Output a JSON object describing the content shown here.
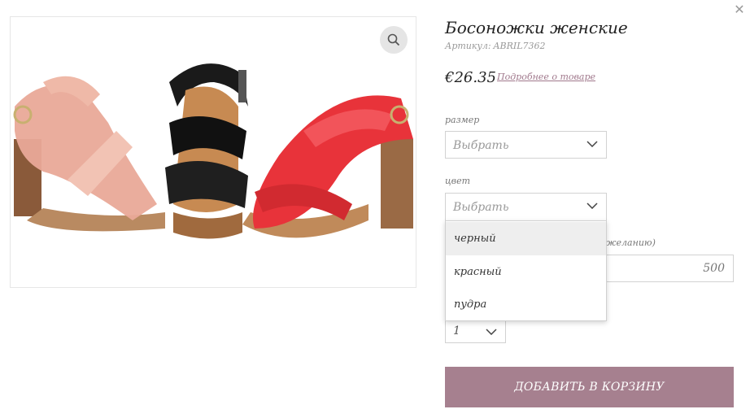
{
  "product": {
    "title": "Босоножки женские",
    "sku_label": "Артикул:",
    "sku_value": "ABRIL7362",
    "price": "€26.35",
    "more_link": "Подробнее о товаре"
  },
  "options": {
    "size": {
      "label": "размер",
      "value": "Выбрать"
    },
    "color": {
      "label": "цвет",
      "value": "Выбрать",
      "open": true,
      "options": [
        "черный",
        "красный",
        "пудра"
      ],
      "highlighted": "черный"
    },
    "partial_label": "желанию)",
    "amount_value": "500",
    "quantity": {
      "value": "1"
    }
  },
  "actions": {
    "add_to_cart": "ДОБАВИТЬ В КОРЗИНУ",
    "close": "✕"
  },
  "icons": {
    "zoom": "search-icon",
    "close": "close-icon",
    "chevron": "chevron-down-icon"
  },
  "colors": {
    "accent": "#a6808f",
    "link": "#a0788c",
    "shoe_pink": "#e9a998",
    "shoe_black": "#1a1a1a",
    "shoe_red": "#e8333a"
  }
}
